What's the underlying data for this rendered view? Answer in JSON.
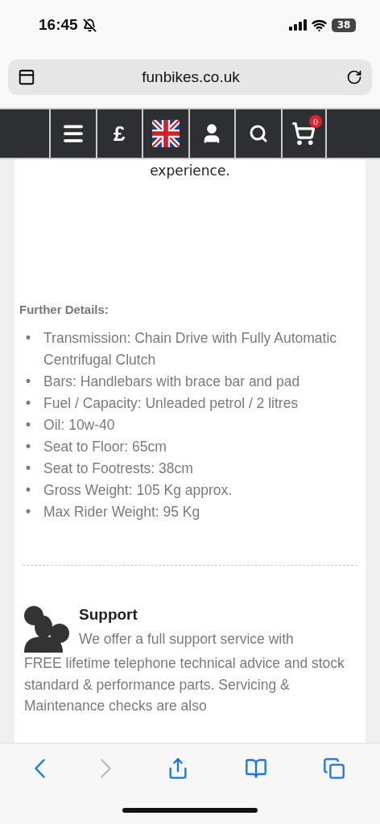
{
  "status_bar": {
    "time": "16:45",
    "battery": "38"
  },
  "address_bar": {
    "url": "funbikes.co.uk"
  },
  "nav": {
    "currency": "£",
    "cart_count": "0"
  },
  "intro": {
    "text": "experience."
  },
  "further_details": {
    "title": "Further Details:",
    "items": [
      {
        "bullet": "•",
        "text": "Transmission: Chain Drive with Fully Automatic Centrifugal Clutch"
      },
      {
        "bullet": "•",
        "text": "Bars: Handlebars with brace bar and pad"
      },
      {
        "bullet": "•",
        "text": "Fuel / Capacity:  Unleaded petrol / 2 litres"
      },
      {
        "bullet": "•",
        "text": "Oil: 10w-40"
      },
      {
        "bullet": "•",
        "text": "Seat to Floor: 65cm"
      },
      {
        "bullet": "•",
        "text": "Seat to Footrests: 38cm"
      },
      {
        "bullet": "•",
        "text": "Gross Weight: 105 Kg approx."
      },
      {
        "bullet": "•",
        "text": "Max Rider Weight: 95 Kg"
      }
    ]
  },
  "support": {
    "title": "Support",
    "text_lines": [
      "We offer a full support service with",
      "FREE lifetime telephone technical advice and stock standard & performance parts. Servicing & Maintenance checks are also"
    ]
  },
  "toolbar": {
    "back_disabled": false,
    "forward_disabled": true
  }
}
